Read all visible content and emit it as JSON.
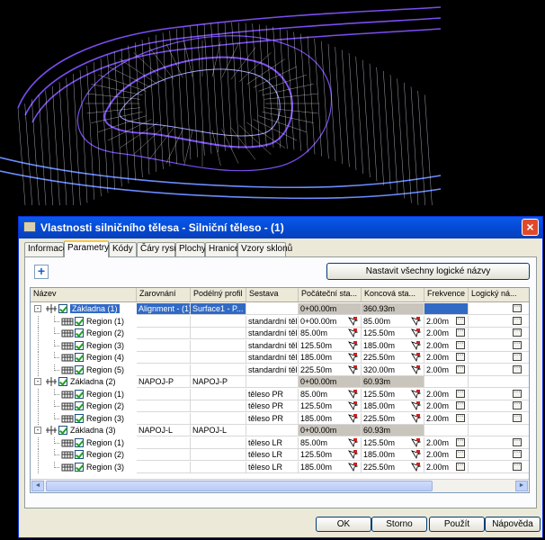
{
  "dialog": {
    "title": "Vlastnosti silničního tělesa - Silniční těleso - (1)",
    "close_label": "×",
    "tabs": [
      {
        "label": "Informace",
        "active": false
      },
      {
        "label": "Parametry",
        "active": true
      },
      {
        "label": "Kódy",
        "active": false
      },
      {
        "label": "Čáry rysu",
        "active": false
      },
      {
        "label": "Plochy",
        "active": false
      },
      {
        "label": "Hranice",
        "active": false
      },
      {
        "label": "Vzory sklonů",
        "active": false
      }
    ],
    "add_button_label": "+",
    "set_names_button": "Nastavit všechny logické názvy",
    "columns": [
      "Název",
      "Zarovnání",
      "Podélný profil",
      "Sestava",
      "Počáteční sta...",
      "Koncová sta...",
      "Frekvence",
      "Logický ná..."
    ],
    "rows": [
      {
        "level": 0,
        "name": "Základna (1)",
        "expand": "-",
        "alignment": "Alignment - (1)",
        "profile": "Surface1 - P...",
        "assembly": "",
        "start": "0+00.00m",
        "end": "360.93m",
        "freq": "",
        "logical": true,
        "selected": true
      },
      {
        "level": 1,
        "name": "Region (1)",
        "alignment": "",
        "profile": "",
        "assembly": "standardní těl...",
        "start": "0+00.00m",
        "end": "85.00m",
        "freq": "2.00m",
        "logical": true
      },
      {
        "level": 1,
        "name": "Region (2)",
        "alignment": "",
        "profile": "",
        "assembly": "standardní těl...",
        "start": "85.00m",
        "end": "125.50m",
        "freq": "2.00m",
        "logical": true
      },
      {
        "level": 1,
        "name": "Region (3)",
        "alignment": "",
        "profile": "",
        "assembly": "standardní těl...",
        "start": "125.50m",
        "end": "185.00m",
        "freq": "2.00m",
        "logical": true
      },
      {
        "level": 1,
        "name": "Region (4)",
        "alignment": "",
        "profile": "",
        "assembly": "standardní těl...",
        "start": "185.00m",
        "end": "225.50m",
        "freq": "2.00m",
        "logical": true
      },
      {
        "level": 1,
        "name": "Region (5)",
        "alignment": "",
        "profile": "",
        "assembly": "standardní těl...",
        "start": "225.50m",
        "end": "320.00m",
        "freq": "2.00m",
        "logical": true
      },
      {
        "level": 0,
        "name": "Základna (2)",
        "expand": "-",
        "alignment": "NAPOJ-P",
        "profile": "NAPOJ-P",
        "assembly": "",
        "start": "0+00.00m",
        "end": "60.93m",
        "freq": "",
        "logical": false
      },
      {
        "level": 1,
        "name": "Region (1)",
        "alignment": "",
        "profile": "",
        "assembly": "těleso PR",
        "start": "85.00m",
        "end": "125.50m",
        "freq": "2.00m",
        "logical": true
      },
      {
        "level": 1,
        "name": "Region (2)",
        "alignment": "",
        "profile": "",
        "assembly": "těleso PR",
        "start": "125.50m",
        "end": "185.00m",
        "freq": "2.00m",
        "logical": true
      },
      {
        "level": 1,
        "name": "Region (3)",
        "alignment": "",
        "profile": "",
        "assembly": "těleso PR",
        "start": "185.00m",
        "end": "225.50m",
        "freq": "2.00m",
        "logical": true
      },
      {
        "level": 0,
        "name": "Základna (3)",
        "expand": "-",
        "alignment": "NAPOJ-L",
        "profile": "NAPOJ-L",
        "assembly": "",
        "start": "0+00.00m",
        "end": "60.93m",
        "freq": "",
        "logical": false
      },
      {
        "level": 1,
        "name": "Region (1)",
        "alignment": "",
        "profile": "",
        "assembly": "těleso LR",
        "start": "85.00m",
        "end": "125.50m",
        "freq": "2.00m",
        "logical": true
      },
      {
        "level": 1,
        "name": "Region (2)",
        "alignment": "",
        "profile": "",
        "assembly": "těleso LR",
        "start": "125.50m",
        "end": "185.00m",
        "freq": "2.00m",
        "logical": true
      },
      {
        "level": 1,
        "name": "Region (3)",
        "alignment": "",
        "profile": "",
        "assembly": "těleso LR",
        "start": "185.00m",
        "end": "225.50m",
        "freq": "2.00m",
        "logical": true
      }
    ],
    "ellipsis_label": "···",
    "scroll_left": "◄",
    "scroll_right": "►",
    "buttons": {
      "ok": "OK",
      "cancel": "Storno",
      "apply": "Použít",
      "help": "Nápověda"
    }
  },
  "colors": {
    "selection": "#316ac5",
    "station_cell": "#c9c4bc",
    "titlebar": "#0348d0",
    "cad_mesh": "#7b4df0"
  }
}
